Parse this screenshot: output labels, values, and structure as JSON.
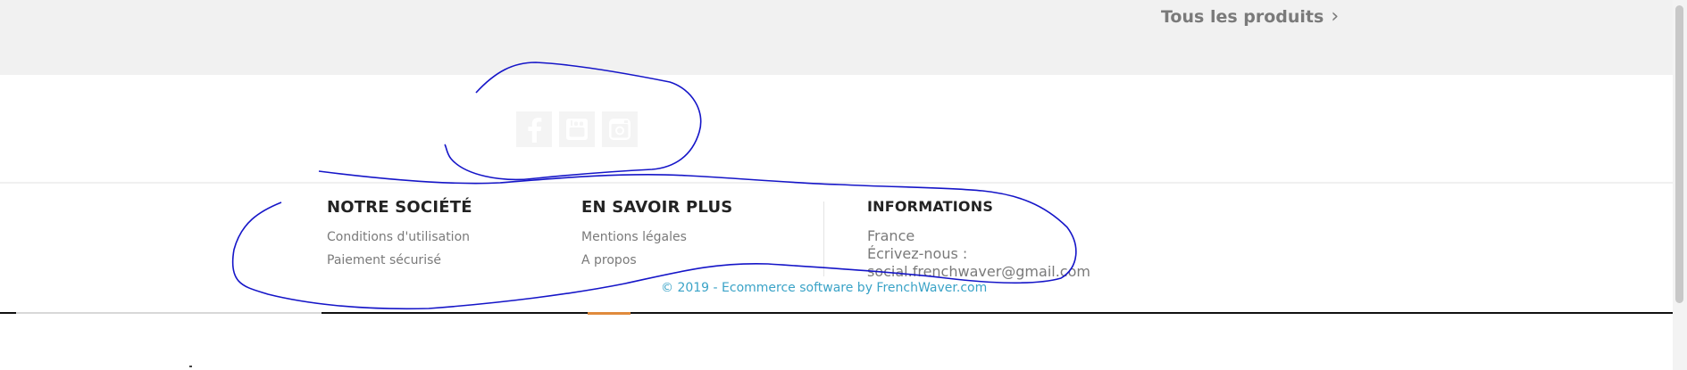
{
  "top_bar": {
    "all_products_label": "Tous les produits",
    "chevron": "›"
  },
  "social": [
    {
      "icon": "facebook-icon"
    },
    {
      "icon": "youtube-icon"
    },
    {
      "icon": "instagram-icon"
    }
  ],
  "footer": {
    "company": {
      "title": "NOTRE SOCIÉTÉ",
      "links": [
        "Conditions d'utilisation",
        "Paiement sécurisé"
      ]
    },
    "learn_more": {
      "title": "EN SAVOIR PLUS",
      "links": [
        "Mentions légales",
        "A propos"
      ]
    },
    "info": {
      "title": "INFORMATIONS",
      "country": "France",
      "write_us": "Écrivez-nous :",
      "email": "social.frenchwaver@gmail.com"
    },
    "copyright": "© 2019 - Ecommerce software by FrenchWaver.com"
  },
  "colors": {
    "top_band": "#f1f1f1",
    "link_grey": "#7a7a7a",
    "heading": "#232323",
    "copyright_blue": "#3aa3c7",
    "annotation_blue": "#1515c8",
    "accent_orange": "#e08a3c"
  }
}
